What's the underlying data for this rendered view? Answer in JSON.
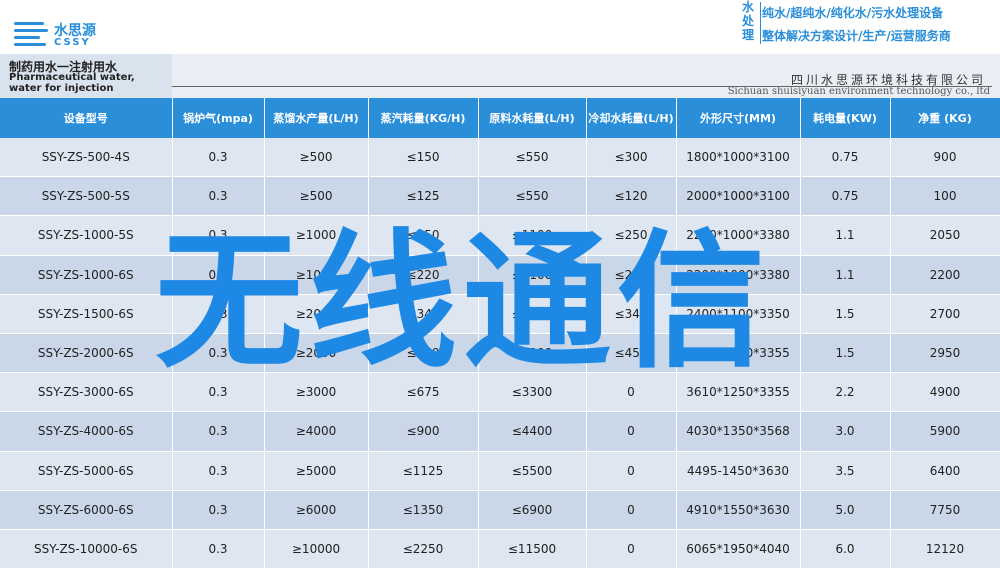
{
  "header": {
    "logo_cn": "水思源",
    "logo_en": "CSSY",
    "badge_chars": [
      "水",
      "处",
      "理"
    ],
    "slogan_line1": "纯水/超纯水/纯化水/污水处理设备",
    "slogan_line2": "整体解决方案设计/生产/运营服务商"
  },
  "title": {
    "cn": "制药用水一注射用水",
    "en": "Pharmaceutical water, water for injection",
    "company_cn": "四川水思源环境科技有限公司",
    "company_en": "Sichuan shuisiyuan environment technology co., ltd"
  },
  "table": {
    "headers": [
      "设备型号",
      "锅炉气(mpa)",
      "蒸馏水产量(L/H)",
      "蒸汽耗量(KG/H)",
      "原料水耗量(L/H)",
      "冷却水耗量(L/H)",
      "外形尺寸(MM)",
      "耗电量(KW)",
      "净重 (KG)"
    ],
    "rows": [
      [
        "SSY-ZS-500-4S",
        "0.3",
        "≥500",
        "≤150",
        "≤550",
        "≤300",
        "1800*1000*3100",
        "0.75",
        "900"
      ],
      [
        "SSY-ZS-500-5S",
        "0.3",
        "≥500",
        "≤125",
        "≤550",
        "≤120",
        "2000*1000*3100",
        "0.75",
        "100"
      ],
      [
        "SSY-ZS-1000-5S",
        "0.3",
        "≥1000",
        "≤250",
        "≤1100",
        "≤250",
        "2200*1000*3380",
        "1.1",
        "2050"
      ],
      [
        "SSY-ZS-1000-6S",
        "0.3",
        "≥1000",
        "≤220",
        "≤1100",
        "≤220",
        "2200*1000*3380",
        "1.1",
        "2200"
      ],
      [
        "SSY-ZS-1500-6S",
        "0.3",
        "≥2000",
        "≤340",
        "≤1700",
        "≤340",
        "2400*1100*3350",
        "1.5",
        "2700"
      ],
      [
        "SSY-ZS-2000-6S",
        "0.3",
        "≥2000",
        "≤450",
        "≤2200",
        "≤450",
        "2800*1100*3355",
        "1.5",
        "2950"
      ],
      [
        "SSY-ZS-3000-6S",
        "0.3",
        "≥3000",
        "≤675",
        "≤3300",
        "0",
        "3610*1250*3355",
        "2.2",
        "4900"
      ],
      [
        "SSY-ZS-4000-6S",
        "0.3",
        "≥4000",
        "≤900",
        "≤4400",
        "0",
        "4030*1350*3568",
        "3.0",
        "5900"
      ],
      [
        "SSY-ZS-5000-6S",
        "0.3",
        "≥5000",
        "≤1125",
        "≤5500",
        "0",
        "4495-1450*3630",
        "3.5",
        "6400"
      ],
      [
        "SSY-ZS-6000-6S",
        "0.3",
        "≥6000",
        "≤1350",
        "≤6900",
        "0",
        "4910*1550*3630",
        "5.0",
        "7750"
      ],
      [
        "SSY-ZS-10000-6S",
        "0.3",
        "≥10000",
        "≤2250",
        "≤11500",
        "0",
        "6065*1950*4040",
        "6.0",
        "12120"
      ]
    ]
  },
  "watermark": "无线通信",
  "colors": {
    "accent": "#2a8fd8",
    "row_light": "#dde6f1",
    "row_dark": "#c9d7e8"
  }
}
